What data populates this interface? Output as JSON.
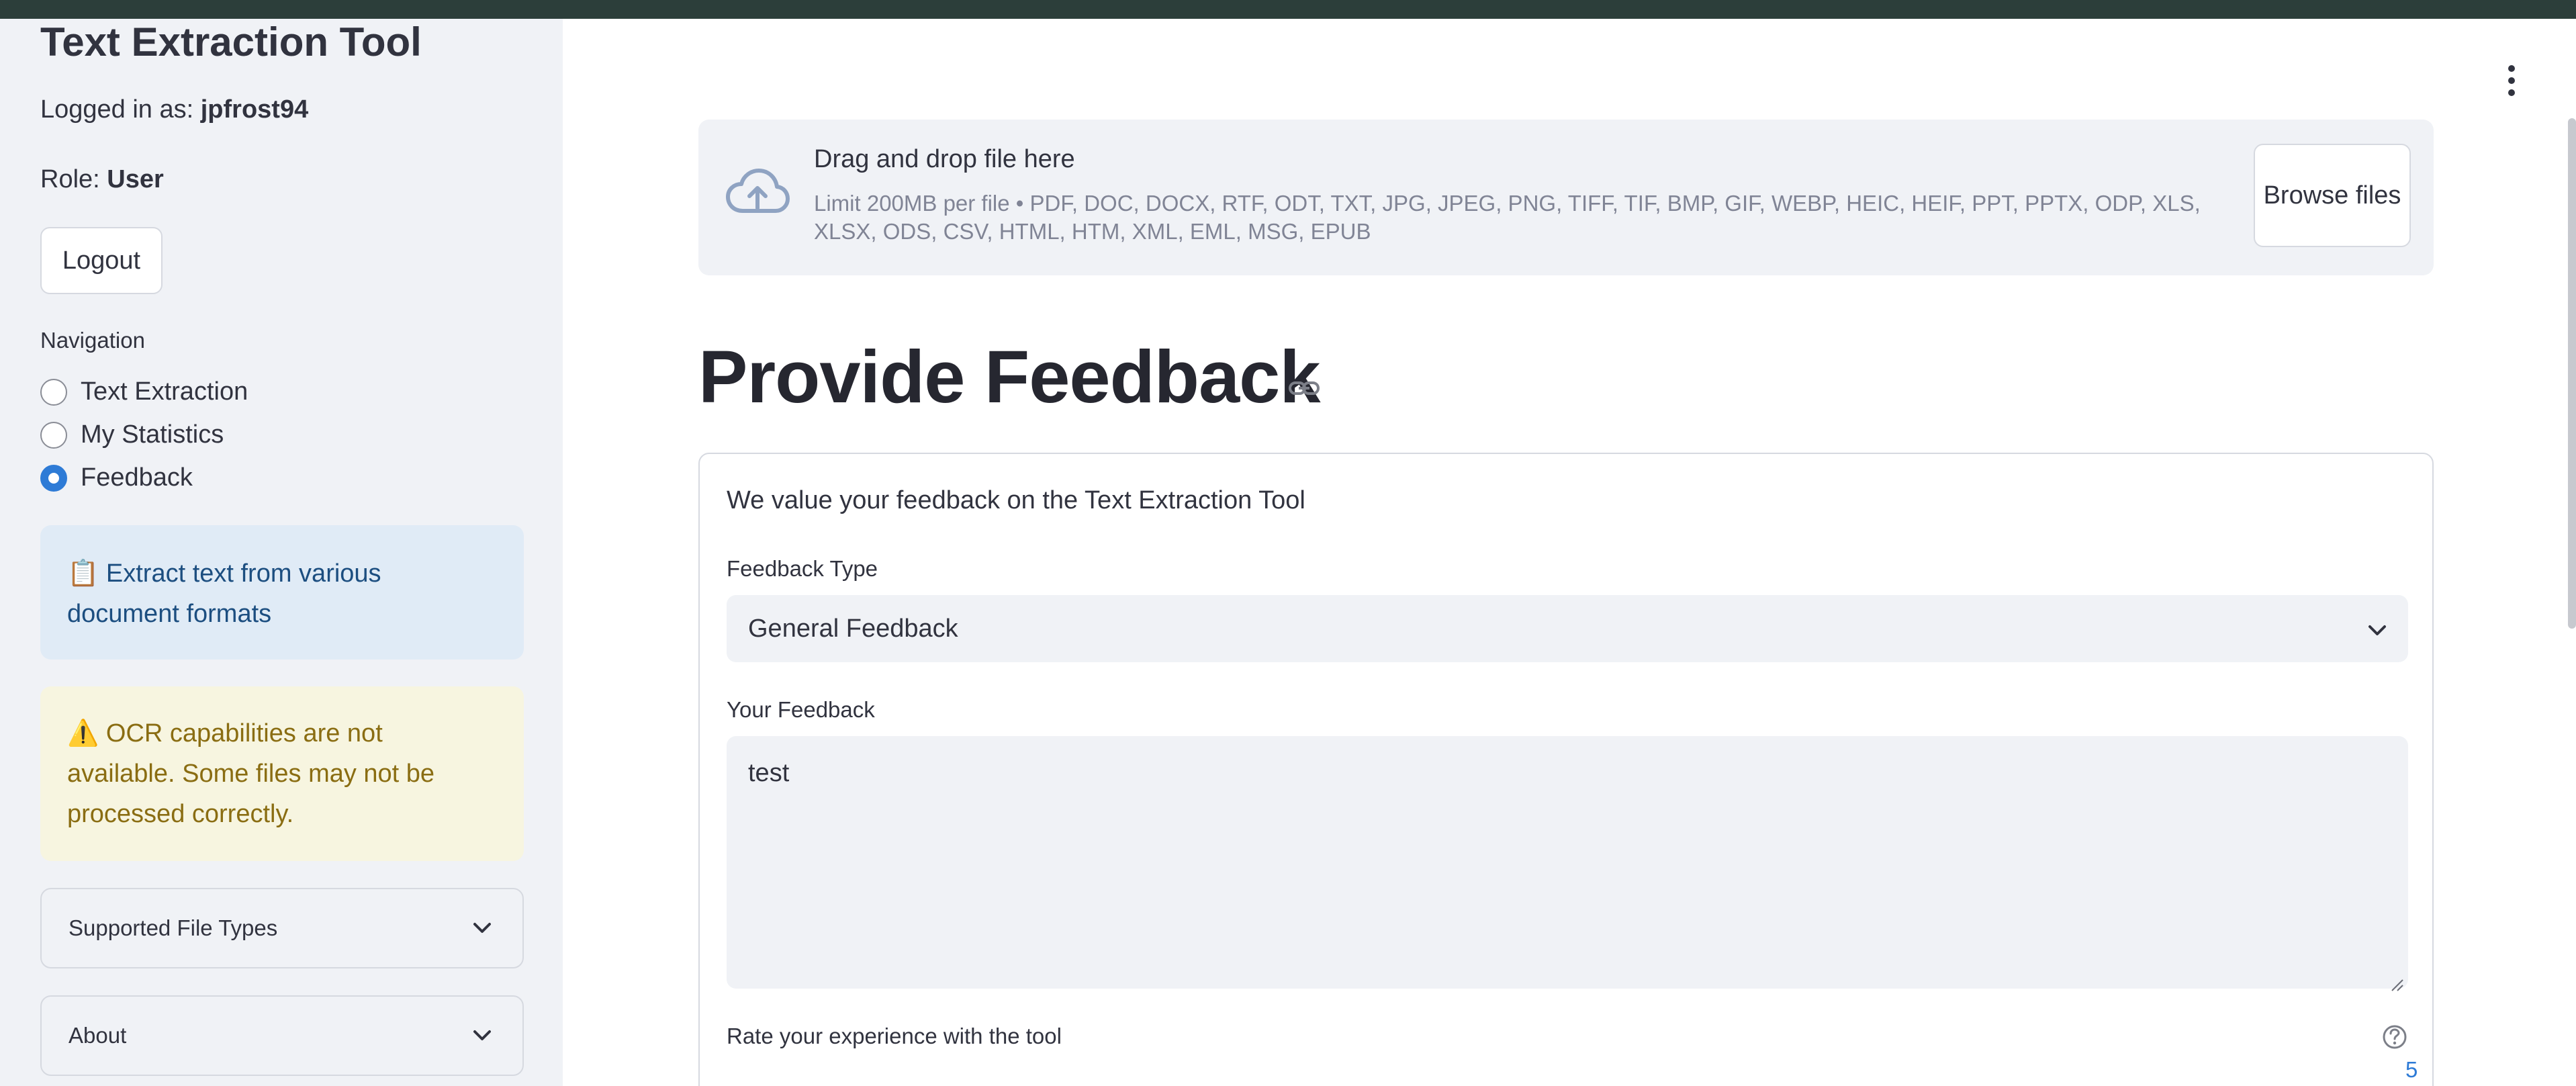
{
  "app": {
    "title": "Text Extraction Tool"
  },
  "sidebar": {
    "logged_in_label": "Logged in as:",
    "username": "jpfrost94",
    "role_label": "Role:",
    "role": "User",
    "logout_label": "Logout",
    "nav_label": "Navigation",
    "nav_items": [
      {
        "label": "Text Extraction",
        "selected": false
      },
      {
        "label": "My Statistics",
        "selected": false
      },
      {
        "label": "Feedback",
        "selected": true
      }
    ],
    "info_icon": "📋",
    "info_text": "Extract text from various document formats",
    "warning_icon": "⚠️",
    "warning_text": "OCR capabilities are not available. Some files may not be processed correctly.",
    "expanders": [
      {
        "label": "Supported File Types"
      },
      {
        "label": "About"
      }
    ]
  },
  "uploader": {
    "title": "Drag and drop file here",
    "limit": "Limit 200MB per file • PDF, DOC, DOCX, RTF, ODT, TXT, JPG, JPEG, PNG, TIFF, TIF, BMP, GIF, WEBP, HEIC, HEIF, PPT, PPTX, ODP, XLS, XLSX, ODS, CSV, HTML, HTM, XML, EML, MSG, EPUB",
    "browse_label": "Browse files",
    "icon": "cloud-upload-icon"
  },
  "feedback": {
    "heading": "Provide Feedback",
    "intro": "We value your feedback on the Text Extraction Tool",
    "type_label": "Feedback Type",
    "type_value": "General Feedback",
    "text_label": "Your Feedback",
    "text_value": "test",
    "rating_label": "Rate your experience with the tool",
    "rating_value": "5"
  },
  "colors": {
    "accent": "#2e7bd6",
    "topbar": "#2c3e3a",
    "sidebar_bg": "#f0f2f6",
    "info_bg": "#e0ebf6",
    "warning_bg": "#f7f5e0"
  }
}
